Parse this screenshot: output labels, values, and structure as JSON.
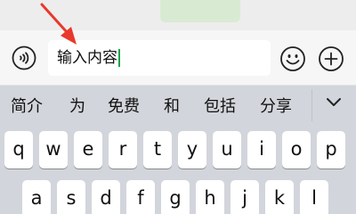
{
  "input_bar": {
    "text_value": "输入内容",
    "voice_icon": "voice-icon",
    "emoji_icon": "emoji-icon",
    "plus_icon": "plus-icon"
  },
  "candidates": [
    "简介",
    "为",
    "免费",
    "和",
    "包括",
    "分享"
  ],
  "collapse_icon": "chevron-down-icon",
  "keyboard": {
    "row1": [
      "q",
      "w",
      "e",
      "r",
      "t",
      "y",
      "u",
      "i",
      "o",
      "p"
    ],
    "row2": [
      "a",
      "s",
      "d",
      "f",
      "g",
      "h",
      "j",
      "k",
      "l"
    ]
  },
  "colors": {
    "caret": "#19a64b",
    "arrow": "#e8392c",
    "keyboard_bg": "#d2d5db",
    "key": "#ffffff"
  }
}
